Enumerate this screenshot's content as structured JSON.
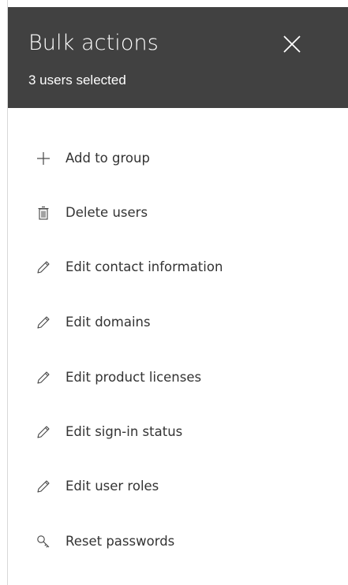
{
  "panel": {
    "title": "Bulk actions",
    "subtitle": "3 users selected",
    "close_icon": "close-icon",
    "header_color": "#414141"
  },
  "actions": [
    {
      "label": "Add to group",
      "icon": "plus-icon"
    },
    {
      "label": "Delete users",
      "icon": "trash-icon"
    },
    {
      "label": "Edit contact information",
      "icon": "pencil-icon"
    },
    {
      "label": "Edit domains",
      "icon": "pencil-icon"
    },
    {
      "label": "Edit product licenses",
      "icon": "pencil-icon"
    },
    {
      "label": "Edit sign-in status",
      "icon": "pencil-icon"
    },
    {
      "label": "Edit user roles",
      "icon": "pencil-icon"
    },
    {
      "label": "Reset passwords",
      "icon": "key-icon"
    }
  ]
}
